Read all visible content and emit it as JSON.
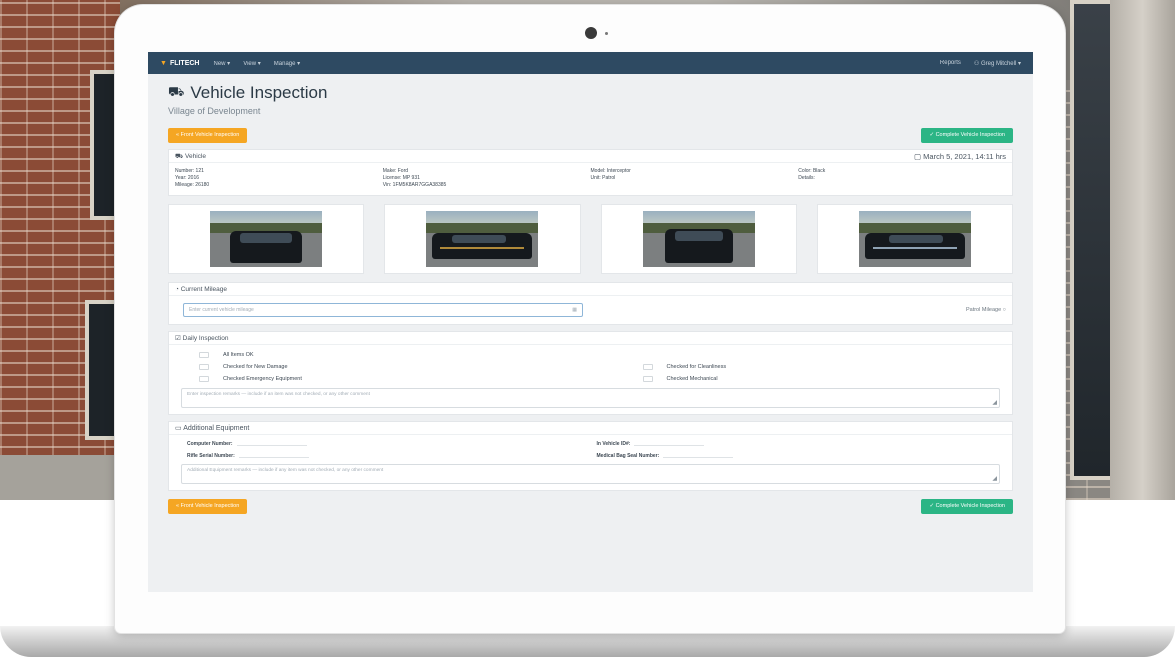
{
  "navbar": {
    "brand": "FLITECH",
    "items": [
      "New ▾",
      "View ▾",
      "Manage ▾"
    ],
    "reports": "Reports",
    "user": "Greg Mitchell ▾"
  },
  "page": {
    "title": "Vehicle Inspection",
    "subtitle": "Village of Development"
  },
  "actions": {
    "top_left": "« Front Vehicle Inspection",
    "top_right": "✓ Complete Vehicle Inspection",
    "bottom_left": "« Front Vehicle Inspection",
    "bottom_right": "✓ Complete Vehicle Inspection"
  },
  "vehicle": {
    "header": "Vehicle",
    "timestamp": "March 5, 2021, 14:11 hrs",
    "col1": {
      "number": "Number: 121",
      "year": "Year: 2016",
      "mileage": "Mileage: 26180"
    },
    "col2": {
      "make": "Make: Ford",
      "license": "License: MP 931",
      "vin": "Vin: 1FM5K8AR7GGA38385"
    },
    "col3": {
      "model": "Model: Interceptor",
      "unit": "Unit: Patrol"
    },
    "col4": {
      "color": "Color: Black",
      "details": "Details:"
    }
  },
  "mileage": {
    "header": "Current Mileage",
    "placeholder": "Enter current vehicle mileage",
    "side_label": "Patrol Mileage"
  },
  "daily": {
    "header": "Daily Inspection",
    "left": [
      "All Items OK",
      "Checked for New Damage",
      "Checked Emergency Equipment"
    ],
    "right": [
      "Checked for Cleanliness",
      "Checked Mechanical"
    ],
    "notes_placeholder": "Enter inspection remarks — include if an item was not checked, or any other comment"
  },
  "equipment": {
    "header": "Additional Equipment",
    "computer": "Computer Number:",
    "rifle": "Rifle Serial Number:",
    "vehicle_id": "In Vehicle ID#:",
    "medical": "Medical Bag Seal Number:",
    "notes_placeholder": "Additional Equipment remarks — include if any item was not checked, or any other comment"
  },
  "icons": {
    "brand": "brand-logo-icon",
    "title": "car-icon",
    "calendar": "calendar-icon"
  },
  "colors": {
    "navbar": "#2e4a62",
    "orange_button": "#f5a623",
    "green_button": "#2bb585",
    "page_bg": "#eef0f2"
  }
}
